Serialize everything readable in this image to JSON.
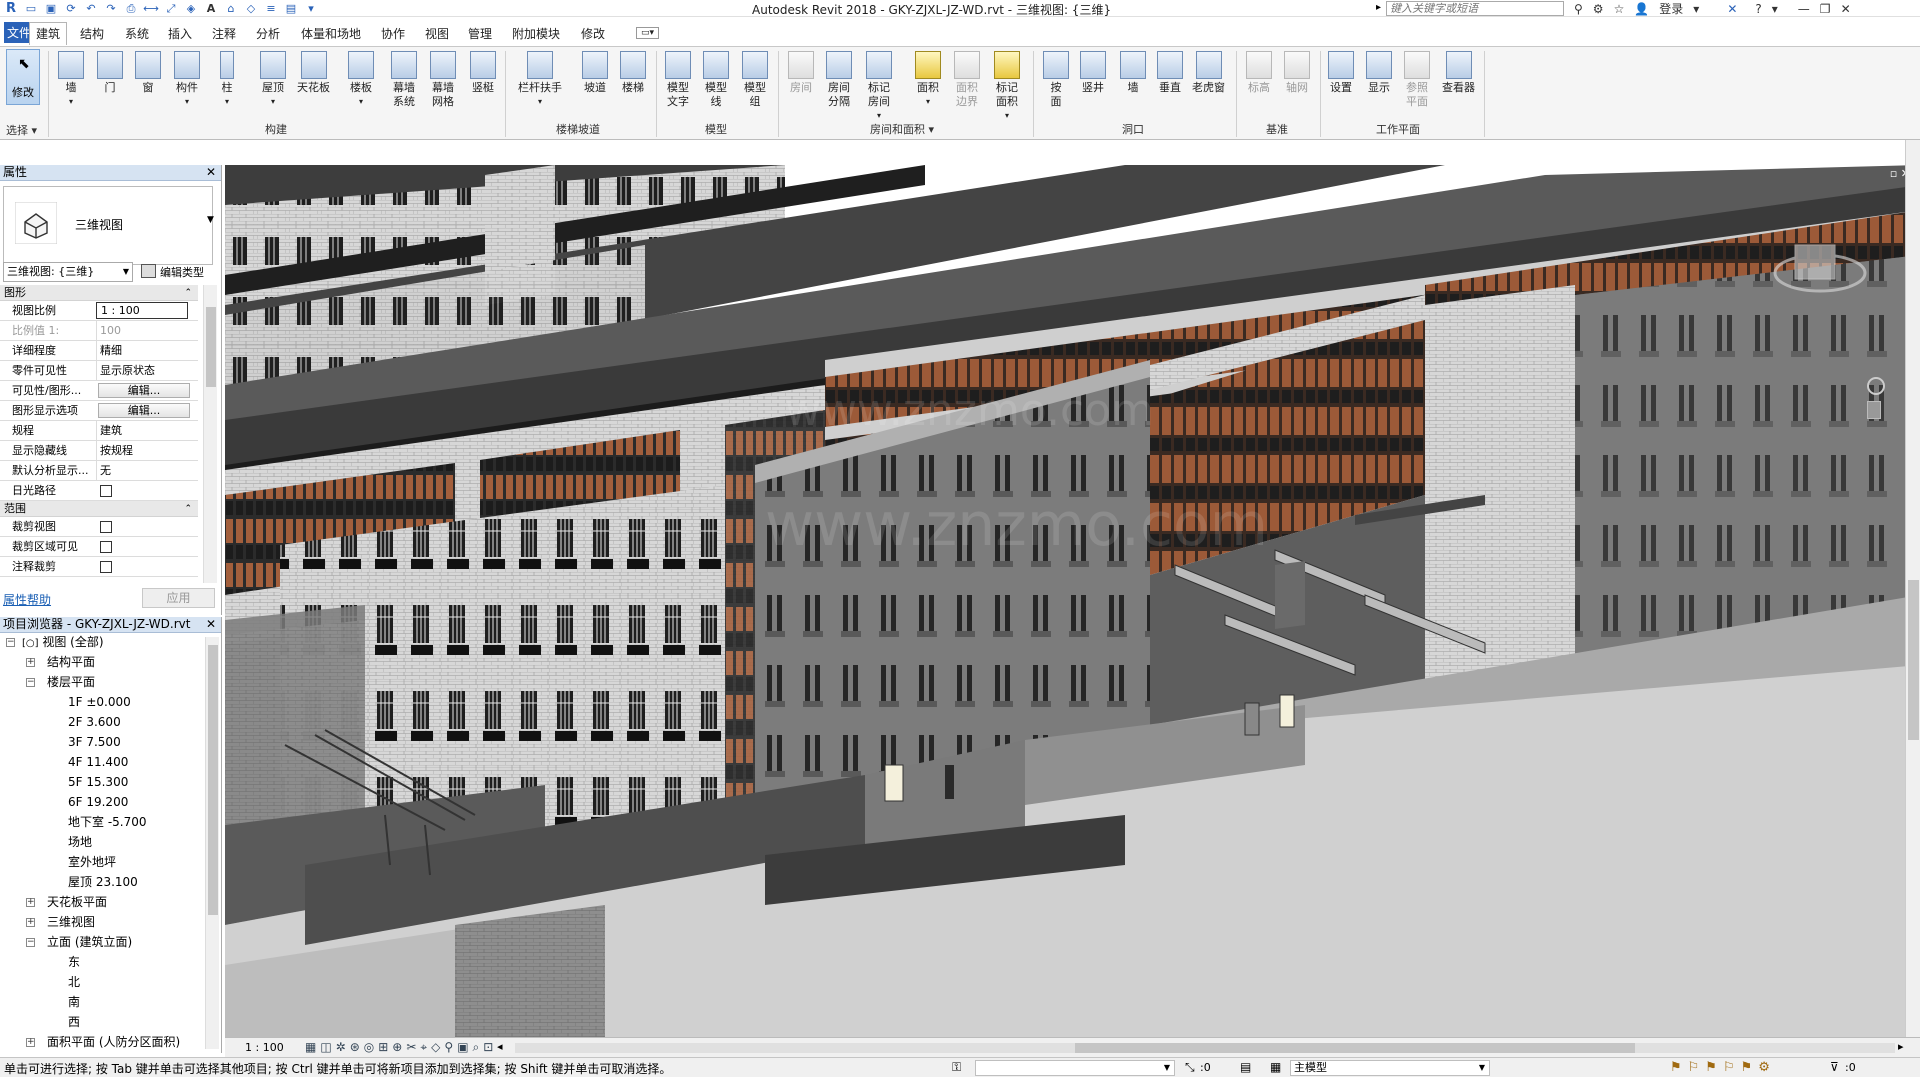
{
  "app": {
    "title": "Autodesk Revit 2018  -  GKY-ZJXL-JZ-WD.rvt - 三维视图: {三维}",
    "search_placeholder": "键入关键字或短语",
    "login": "登录",
    "brand_color": "#2a62b8"
  },
  "menu": {
    "file": "文件",
    "tabs": [
      "建筑",
      "结构",
      "系统",
      "插入",
      "注释",
      "分析",
      "体量和场地",
      "协作",
      "视图",
      "管理",
      "附加模块",
      "修改"
    ],
    "active": "建筑"
  },
  "ribbon": {
    "modify": "修改",
    "select": "选择",
    "build": {
      "label": "构建",
      "buttons": [
        "墙",
        "门",
        "窗",
        "构件",
        "柱",
        "屋顶",
        "天花板",
        "楼板",
        "幕墙\n系统",
        "幕墙\n网格",
        "竖梃"
      ]
    },
    "stair": {
      "label": "楼梯坡道",
      "buttons": [
        "栏杆扶手",
        "坡道",
        "楼梯"
      ]
    },
    "model": {
      "label": "模型",
      "buttons": [
        "模型\n文字",
        "模型\n线",
        "模型\n组"
      ]
    },
    "room": {
      "label": "房间和面积",
      "buttons": [
        "房间",
        "房间\n分隔",
        "标记\n房间",
        "面积",
        "面积\n边界",
        "标记\n面积"
      ]
    },
    "opening": {
      "label": "洞口",
      "buttons": [
        "按\n面",
        "竖井",
        "墙",
        "垂直",
        "老虎窗"
      ]
    },
    "datum": {
      "label": "基准",
      "buttons": [
        "标高",
        "轴网"
      ]
    },
    "workplane": {
      "label": "工作平面",
      "buttons": [
        "设置",
        "显示",
        "参照\n平面",
        "查看器"
      ]
    }
  },
  "properties": {
    "header": "属性",
    "type_name": "三维视图",
    "view_selector": "三维视图: {三维}",
    "edit_type": "编辑类型",
    "groups": {
      "graphics": "图形",
      "extents": "范围"
    },
    "rows": [
      {
        "key": "视图比例",
        "value": "1 : 100"
      },
      {
        "key": "比例值 1:",
        "value": "100"
      },
      {
        "key": "详细程度",
        "value": "精细"
      },
      {
        "key": "零件可见性",
        "value": "显示原状态"
      },
      {
        "key": "可见性/图形...",
        "value": "编辑..."
      },
      {
        "key": "图形显示选项",
        "value": "编辑..."
      },
      {
        "key": "规程",
        "value": "建筑"
      },
      {
        "key": "显示隐藏线",
        "value": "按规程"
      },
      {
        "key": "默认分析显示...",
        "value": "无"
      },
      {
        "key": "日光路径",
        "value": ""
      }
    ],
    "extent_rows": [
      {
        "key": "裁剪视图",
        "value": ""
      },
      {
        "key": "裁剪区域可见",
        "value": ""
      },
      {
        "key": "注释裁剪",
        "value": ""
      }
    ],
    "help": "属性帮助",
    "apply": "应用"
  },
  "browser": {
    "header": "项目浏览器 - GKY-ZJXL-JZ-WD.rvt",
    "root": "视图 (全部)",
    "nodes": {
      "struct_plan": "结构平面",
      "floor_plan": "楼层平面",
      "floors": [
        "1F ±0.000",
        "2F 3.600",
        "3F 7.500",
        "4F 11.400",
        "5F 15.300",
        "6F 19.200",
        "地下室 -5.700",
        "场地",
        "室外地坪",
        "屋顶 23.100"
      ],
      "ceiling_plan": "天花板平面",
      "view3d": "三维视图",
      "elevation": "立面 (建筑立面)",
      "elevations": [
        "东",
        "北",
        "南",
        "西"
      ],
      "area_plan": "面积平面 (人防分区面积)"
    }
  },
  "view_control": {
    "scale": "1 : 100"
  },
  "status": {
    "message": "单击可进行选择; 按 Tab 键并单击可选择其他项目; 按 Ctrl 键并单击可将新项目添加到选择集; 按 Shift 键并单击可取消选择。",
    "selection_count": ":0",
    "model": "主模型",
    "filter_count": ":0"
  }
}
